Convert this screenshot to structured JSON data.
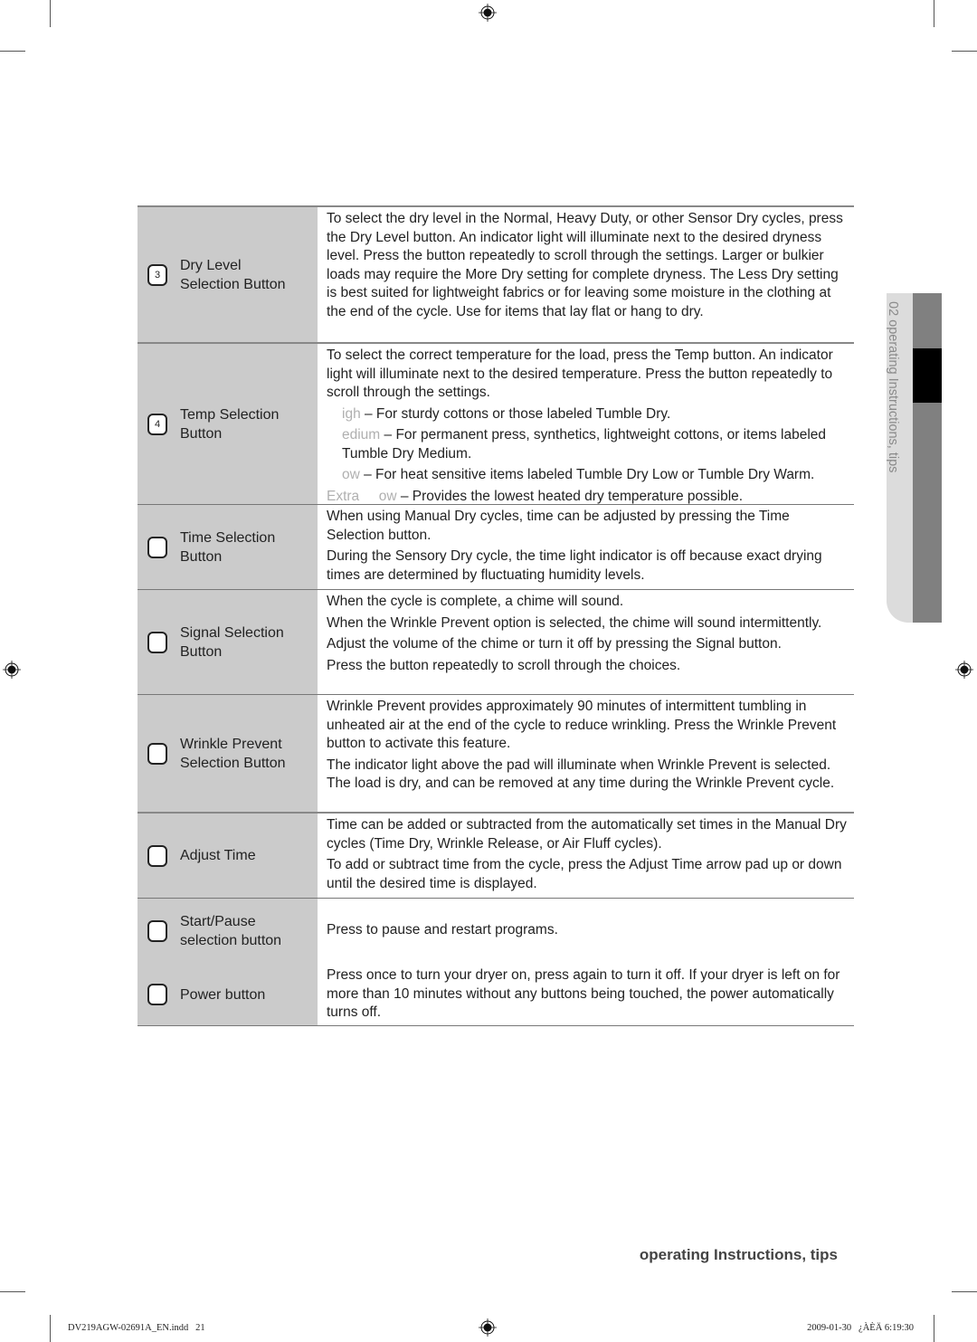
{
  "side_tab": {
    "label": "02 operating Instructions, tips"
  },
  "footer": {
    "section_title": "operating Instructions, tips",
    "slug_file": "DV219AGW-02691A_EN.indd   21",
    "slug_timestamp": "2009-01-30   ¿ÀÈÄ 6:19:30"
  },
  "rows": [
    {
      "badge": "3",
      "label": "Dry Level\nSelection Button",
      "paragraphs": [
        "To select the dry level in the Normal, Heavy Duty, or other Sensor Dry cycles, press the Dry Level button. An indicator light will illuminate next to the desired dryness level. Press the button repeatedly to scroll through the settings. Larger or bulkier loads may require the More Dry setting for complete dryness. The Less Dry setting is best suited for lightweight fabrics or for leaving some moisture in the clothing at the end of the cycle.  Use for items that lay flat or hang to dry."
      ]
    },
    {
      "badge": "4",
      "label": "Temp Selection\nButton",
      "intro": "To select the correct temperature for the load, press the Temp button. An indicator light will illuminate next to the desired temperature. Press the button repeatedly to scroll through the settings.",
      "settings": [
        {
          "name": "igh",
          "text": " – For sturdy cottons or those labeled Tumble Dry."
        },
        {
          "name": "edium",
          "text": " – For permanent press, synthetics, lightweight cottons, or items labeled Tumble Dry Medium."
        },
        {
          "name": "ow",
          "text": " – For heat sensitive items labeled Tumble Dry Low or Tumble Dry Warm."
        },
        {
          "name": "Extra     ow",
          "text": " – Provides the lowest heated dry temperature possible."
        }
      ]
    },
    {
      "badge": "",
      "label": "Time Selection\nButton",
      "paragraphs": [
        "When using Manual Dry cycles, time can be adjusted by pressing the Time Selection button.",
        "During the Sensory Dry cycle, the time light indicator is off because exact drying times are determined by fluctuating humidity levels."
      ]
    },
    {
      "badge": "",
      "label": "Signal Selection\nButton",
      "paragraphs": [
        "When the cycle is complete, a chime will sound.",
        "When the Wrinkle Prevent option is selected, the chime will sound intermittently.",
        "Adjust the volume of the chime or turn it off by pressing the Signal button.",
        "Press the button repeatedly to scroll through the choices."
      ]
    },
    {
      "badge": "",
      "label": "Wrinkle Prevent\nSelection Button",
      "paragraphs": [
        "Wrinkle Prevent provides approximately 90 minutes of intermittent tumbling in unheated air at the end of the cycle to reduce wrinkling. Press the Wrinkle Prevent button to activate this feature.",
        "The indicator light above the pad will illuminate when Wrinkle Prevent is selected. The load is dry, and can be removed at any time during the Wrinkle Prevent cycle."
      ]
    },
    {
      "badge": "",
      "label": "Adjust Time",
      "paragraphs": [
        "Time can be added or subtracted from the automatically set times in the Manual Dry cycles (Time Dry, Wrinkle Release, or Air Fluff cycles).",
        "To add or subtract time from the cycle, press the Adjust Time arrow pad up or down until the desired time is displayed."
      ]
    },
    {
      "badge": "",
      "label": "Start/Pause\nselection button",
      "paragraphs": [
        "Press to pause and restart programs."
      ]
    },
    {
      "badge": "",
      "label": "Power button",
      "paragraphs": [
        "Press once to turn your dryer on, press again to turn it off. If your dryer is left on for more than 10 minutes without any buttons being touched, the power automatically turns off."
      ]
    }
  ]
}
